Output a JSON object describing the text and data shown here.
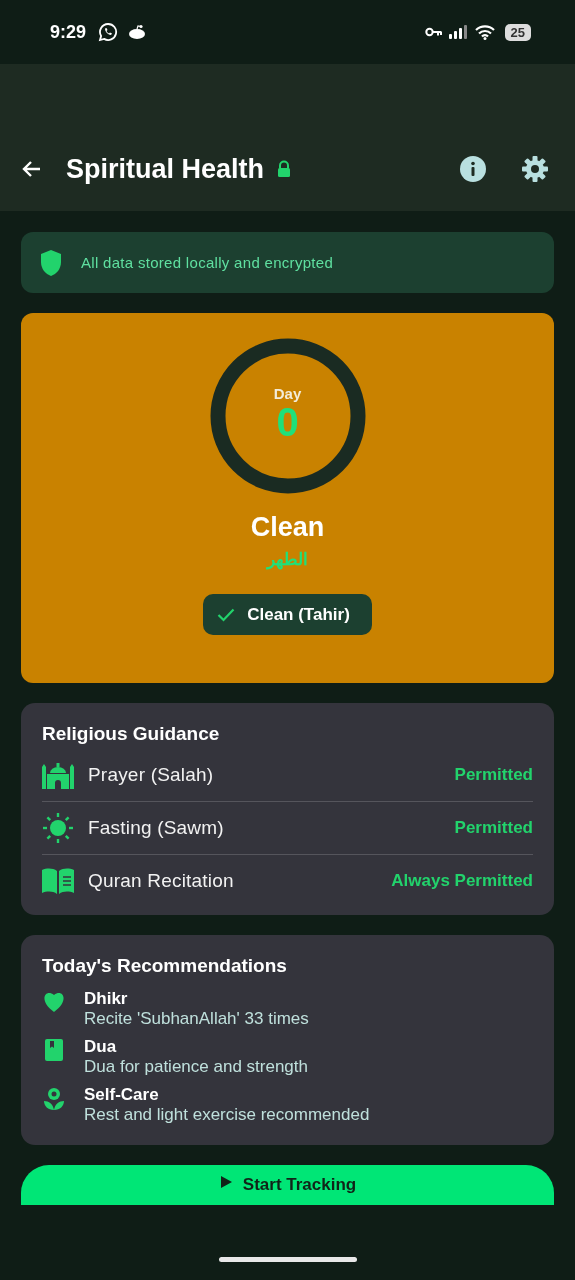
{
  "status_bar": {
    "time": "9:29",
    "battery": "25"
  },
  "app_bar": {
    "title": "Spiritual Health"
  },
  "notice": {
    "text": "All data stored locally and encrypted"
  },
  "status_card": {
    "day_label": "Day",
    "day_count": "0",
    "state": "Clean",
    "state_arabic": "الطهر",
    "badge": "Clean (Tahir)"
  },
  "guidance": {
    "title": "Religious Guidance",
    "items": [
      {
        "label": "Prayer (Salah)",
        "status": "Permitted"
      },
      {
        "label": "Fasting (Sawm)",
        "status": "Permitted"
      },
      {
        "label": "Quran Recitation",
        "status": "Always Permitted"
      }
    ]
  },
  "recommendations": {
    "title": "Today's Recommendations",
    "items": [
      {
        "title": "Dhikr",
        "text": "Recite 'SubhanAllah' 33 times"
      },
      {
        "title": "Dua",
        "text": "Dua for patience and strength"
      },
      {
        "title": "Self-Care",
        "text": "Rest and light exercise recommended"
      }
    ]
  },
  "primary_button": {
    "label": "Start Tracking"
  }
}
